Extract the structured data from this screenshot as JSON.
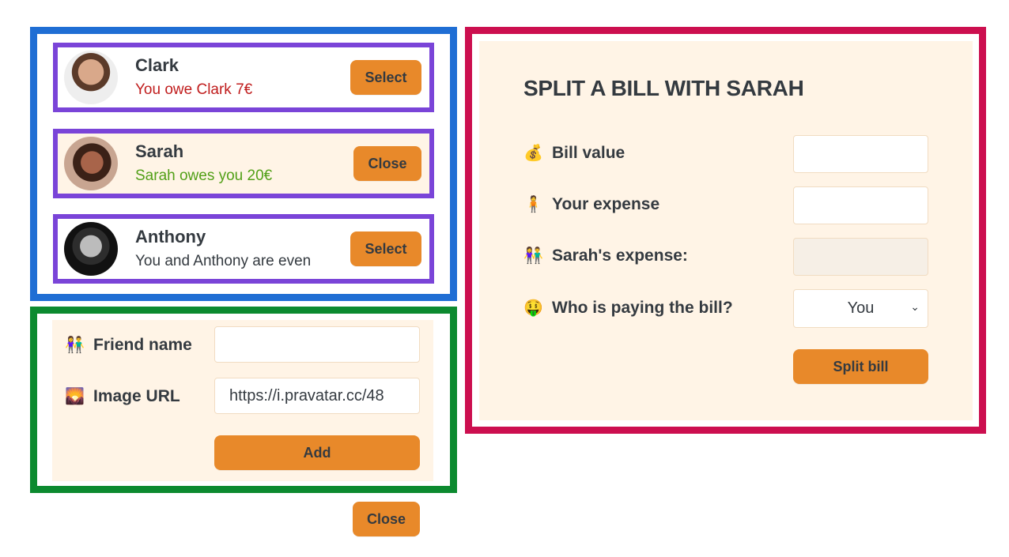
{
  "friends": [
    {
      "name": "Clark",
      "status": "You owe Clark 7€",
      "button": "Select"
    },
    {
      "name": "Sarah",
      "status": "Sarah owes you 20€",
      "button": "Close"
    },
    {
      "name": "Anthony",
      "status": "You and Anthony are even",
      "button": "Select"
    }
  ],
  "add_friend": {
    "name_emoji": "👫",
    "name_label": "Friend name",
    "name_value": "",
    "image_emoji": "🌄",
    "image_label": "Image URL",
    "image_value": "https://i.pravatar.cc/48",
    "add_button": "Add"
  },
  "close_button": "Close",
  "split": {
    "title": "SPLIT A BILL WITH SARAH",
    "bill_emoji": "💰",
    "bill_label": "Bill value",
    "expense_emoji": "🧍",
    "expense_label": "Your expense",
    "friend_emoji": "👫",
    "friend_label": "Sarah's expense:",
    "payer_emoji": "🤑",
    "payer_label": "Who is paying the bill?",
    "payer_value": "You",
    "submit_button": "Split bill"
  },
  "colors": {
    "accent": "#e8892a",
    "panel_bg": "#fff4e6",
    "frame_blue": "#1f6ed4",
    "frame_green": "#0c8a2f",
    "frame_red": "#cc0f4f",
    "frame_purple": "#7a44d8",
    "owe_red": "#c01d1d",
    "owed_green": "#52a018"
  }
}
